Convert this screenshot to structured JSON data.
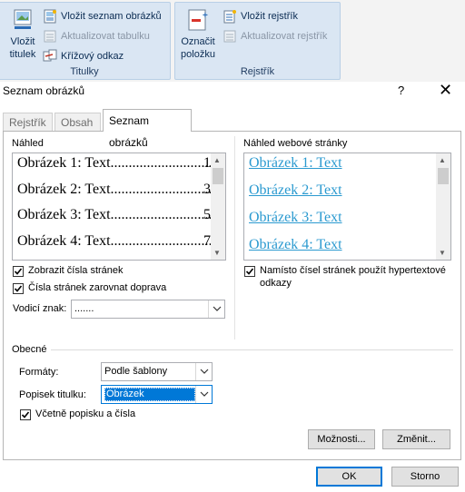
{
  "ribbon": {
    "titulky": {
      "group_label": "Titulky",
      "insert_caption_line1": "Vložit",
      "insert_caption_line2": "titulek",
      "insert_table_of_figures": "Vložit seznam obrázků",
      "update_table": "Aktualizovat tabulku",
      "cross_reference": "Křížový odkaz"
    },
    "rejstrik": {
      "group_label": "Rejstřík",
      "mark_entry_line1": "Označit",
      "mark_entry_line2": "položku",
      "insert_index": "Vložit rejstřík",
      "update_index": "Aktualizovat rejstřík"
    }
  },
  "dialog": {
    "title": "Seznam obrázků",
    "help": "?",
    "close": "✕",
    "tabs": [
      "Rejstřík",
      "Obsah",
      "Seznam obrázků"
    ],
    "print_preview_label": "Náhled",
    "print_preview": [
      {
        "text": "Obrázek 1: Text",
        "leader": "............................",
        "page": "1"
      },
      {
        "text": "Obrázek 2: Text",
        "leader": "............................",
        "page": "3"
      },
      {
        "text": "Obrázek 3: Text",
        "leader": "............................",
        "page": "5"
      },
      {
        "text": "Obrázek 4: Text",
        "leader": "............................",
        "page": "7"
      }
    ],
    "web_preview_label": "Náhled webové stránky",
    "web_preview": [
      "Obrázek 1: Text",
      "Obrázek 2: Text",
      "Obrázek 3: Text",
      "Obrázek 4: Text"
    ],
    "show_page_numbers": {
      "label": "Zobrazit čísla stránek",
      "checked": true
    },
    "right_align": {
      "label": "Čísla stránek zarovnat doprava",
      "checked": true
    },
    "use_hyperlinks": {
      "label_line1": "Namísto čísel stránek použít hypertextové",
      "label_line2": "odkazy",
      "checked": true
    },
    "tab_leader": {
      "label": "Vodicí znak:",
      "value": "......."
    },
    "general_label": "Obecné",
    "formats": {
      "label": "Formáty:",
      "value": "Podle šablony"
    },
    "caption_label": {
      "label": "Popisek titulku:",
      "value": "Obrázek"
    },
    "include_label": {
      "label": "Včetně popisku a čísla",
      "checked": true
    },
    "options_button": "Možnosti...",
    "modify_button": "Změnit...",
    "ok_button": "OK",
    "cancel_button": "Storno"
  }
}
